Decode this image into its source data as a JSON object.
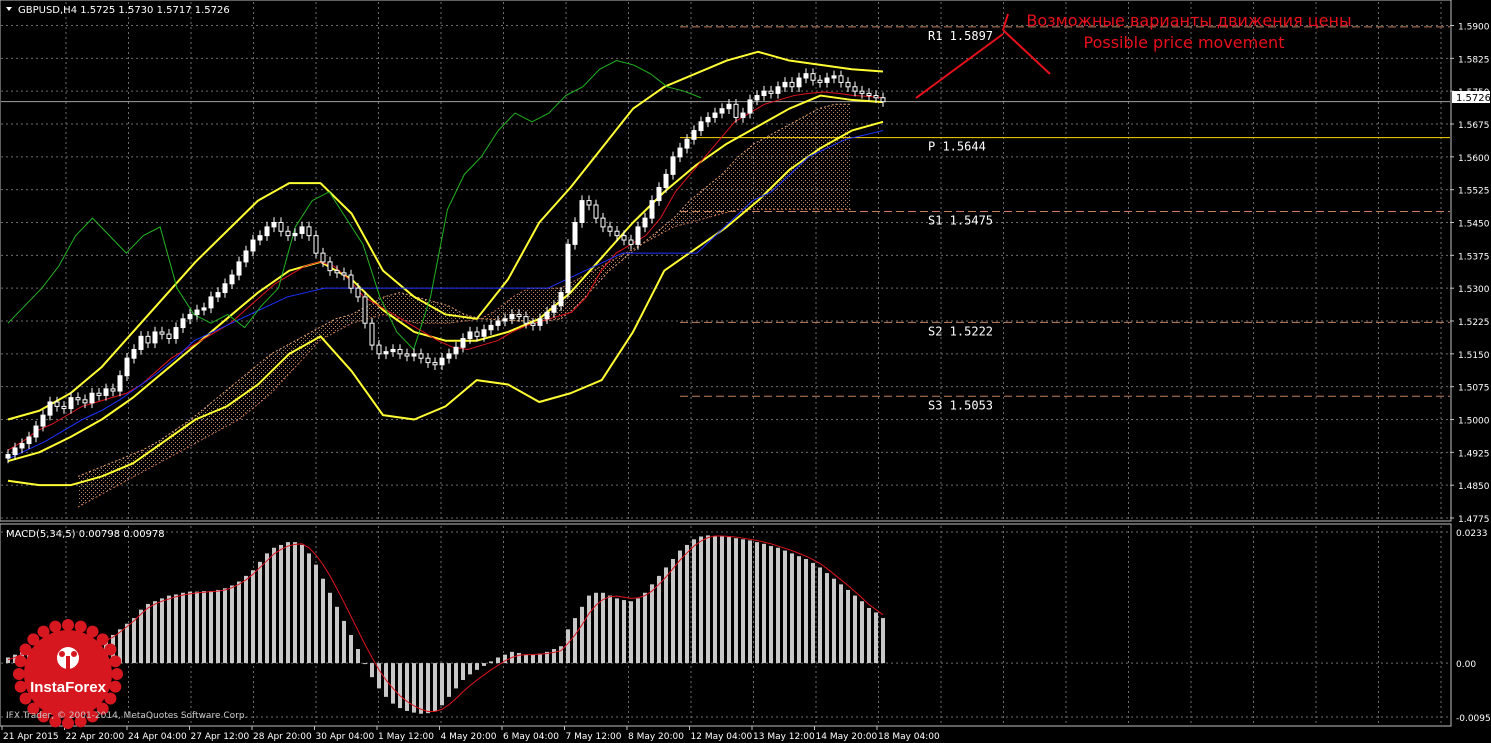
{
  "chart_data": [
    {
      "type": "candlestick",
      "instrument_line": "GBPUSD,H4  1.5725 1.5730 1.5717 1.5726",
      "last_price": "1.5726",
      "y_range": [
        1.4775,
        1.594
      ],
      "y_ticks": [
        "1.5900",
        "1.5825",
        "1.5750",
        "1.5675",
        "1.5600",
        "1.5525",
        "1.5450",
        "1.5375",
        "1.5300",
        "1.5225",
        "1.5150",
        "1.5075",
        "1.5000",
        "1.4925",
        "1.4850",
        "1.4775"
      ],
      "x_labels": [
        "21 Apr 2015",
        "22 Apr 20:00",
        "24 Apr 04:00",
        "27 Apr 12:00",
        "28 Apr 20:00",
        "30 Apr 04:00",
        "1 May 12:00",
        "4 May 20:00",
        "6 May 04:00",
        "7 May 12:00",
        "8 May 20:00",
        "12 May 04:00",
        "13 May 12:00",
        "14 May 20:00",
        "18 May 04:00"
      ],
      "levels": [
        {
          "label": "R1  1.5897",
          "value": 1.5897,
          "color": "#c08060",
          "style": "dashed"
        },
        {
          "label": "P  1.5644",
          "value": 1.5644,
          "color": "#ffd700",
          "style": "solid"
        },
        {
          "label": "S1  1.5475",
          "value": 1.5475,
          "color": "#c08060",
          "style": "dashed"
        },
        {
          "label": "S2  1.5222",
          "value": 1.5222,
          "color": "#c08060",
          "style": "dashed"
        },
        {
          "label": "S3  1.5053",
          "value": 1.5053,
          "color": "#c08060",
          "style": "dashed"
        }
      ],
      "annotation": {
        "line1": "Возможные варианты движения цены",
        "line2": "Possible price movement",
        "color": "#e8101a"
      },
      "closes": [
        1.492,
        1.4935,
        1.4945,
        1.496,
        1.4985,
        1.501,
        1.504,
        1.503,
        1.5025,
        1.505,
        1.5045,
        1.5038,
        1.506,
        1.5055,
        1.507,
        1.5065,
        1.51,
        1.514,
        1.516,
        1.519,
        1.5175,
        1.52,
        1.5195,
        1.5185,
        1.521,
        1.523,
        1.524,
        1.525,
        1.5255,
        1.528,
        1.529,
        1.531,
        1.533,
        1.536,
        1.5385,
        1.541,
        1.542,
        1.544,
        1.545,
        1.543,
        1.542,
        1.5425,
        1.544,
        1.542,
        1.538,
        1.536,
        1.534,
        1.5335,
        1.533,
        1.53,
        1.528,
        1.522,
        1.517,
        1.515,
        1.5155,
        1.516,
        1.515,
        1.5145,
        1.515,
        1.514,
        1.513,
        1.5125,
        1.514,
        1.515,
        1.5165,
        1.5185,
        1.52,
        1.519,
        1.5205,
        1.5215,
        1.5225,
        1.523,
        1.524,
        1.5235,
        1.522,
        1.5215,
        1.523,
        1.5245,
        1.526,
        1.529,
        1.54,
        1.545,
        1.55,
        1.549,
        1.546,
        1.544,
        1.543,
        1.542,
        1.541,
        1.54,
        1.544,
        1.546,
        1.55,
        1.553,
        1.556,
        1.56,
        1.562,
        1.564,
        1.566,
        1.568,
        1.569,
        1.57,
        1.571,
        1.572,
        1.569,
        1.57,
        1.573,
        1.574,
        1.575,
        1.5745,
        1.576,
        1.577,
        1.576,
        1.578,
        1.579,
        1.5775,
        1.577,
        1.578,
        1.5785,
        1.577,
        1.576,
        1.575,
        1.5745,
        1.574,
        1.5735,
        1.5726
      ],
      "ichimoku": {
        "tenkan": [
          1.493,
          1.495,
          1.4975,
          1.499,
          1.501,
          1.503,
          1.504,
          1.505,
          1.506,
          1.508,
          1.511,
          1.514,
          1.516,
          1.518,
          1.52,
          1.522,
          1.525,
          1.528,
          1.531,
          1.533,
          1.535,
          1.536,
          1.535,
          1.532,
          1.528,
          1.526,
          1.524,
          1.522,
          1.52,
          1.518,
          1.5165,
          1.516,
          1.517,
          1.518,
          1.52,
          1.5215,
          1.5225,
          1.5235,
          1.5245,
          1.528,
          1.534,
          1.538,
          1.54,
          1.542,
          1.546,
          1.552,
          1.556,
          1.56,
          1.564,
          1.568,
          1.57,
          1.572,
          1.573,
          1.574,
          1.5745,
          1.5748,
          1.5745,
          1.574,
          1.5738,
          1.5735
        ],
        "kijun": [
          1.491,
          1.493,
          1.495,
          1.4975,
          1.5,
          1.502,
          1.5045,
          1.5075,
          1.5105,
          1.514,
          1.518,
          1.52,
          1.522,
          1.524,
          1.526,
          1.528,
          1.529,
          1.53,
          1.53,
          1.53,
          1.53,
          1.53,
          1.53,
          1.53,
          1.53,
          1.53,
          1.53,
          1.53,
          1.53,
          1.53,
          1.532,
          1.534,
          1.536,
          1.538,
          1.538,
          1.538,
          1.538,
          1.538,
          1.542,
          1.546,
          1.55,
          1.552,
          1.556,
          1.56,
          1.562,
          1.564,
          1.565,
          1.566
        ],
        "chikou": [
          1.522,
          1.526,
          1.53,
          1.535,
          1.542,
          1.546,
          1.542,
          1.538,
          1.542,
          1.544,
          1.53,
          1.524,
          1.522,
          1.524,
          1.521,
          1.526,
          1.53,
          1.544,
          1.55,
          1.552,
          1.546,
          1.54,
          1.528,
          1.52,
          1.516,
          1.528,
          1.548,
          1.556,
          1.56,
          1.566,
          1.57,
          1.568,
          1.57,
          1.574,
          1.576,
          1.58,
          1.582,
          1.581,
          1.579,
          1.576,
          1.575,
          1.5735
        ],
        "span_a": [
          1.487,
          1.4885,
          1.49,
          1.4915,
          1.493,
          1.495,
          1.4975,
          1.5,
          1.503,
          1.506,
          1.509,
          1.512,
          1.515,
          1.517,
          1.519,
          1.521,
          1.523,
          1.524,
          1.526,
          1.528,
          1.529,
          1.528,
          1.527,
          1.526,
          1.524,
          1.523,
          1.5228,
          1.5226,
          1.5225,
          1.5225,
          1.523,
          1.526,
          1.53,
          1.534,
          1.537,
          1.54,
          1.543,
          1.546,
          1.55,
          1.553,
          1.556,
          1.56,
          1.563,
          1.565,
          1.567,
          1.569,
          1.571,
          1.572,
          1.572
        ],
        "span_b": [
          1.48,
          1.482,
          1.484,
          1.486,
          1.488,
          1.49,
          1.492,
          1.494,
          1.496,
          1.498,
          1.5,
          1.503,
          1.506,
          1.51,
          1.514,
          1.518,
          1.52,
          1.522,
          1.523,
          1.524,
          1.523,
          1.522,
          1.522,
          1.522,
          1.5225,
          1.523,
          1.525,
          1.528,
          1.53,
          1.53,
          1.53,
          1.532,
          1.534,
          1.536,
          1.538,
          1.54,
          1.542,
          1.544,
          1.545,
          1.546,
          1.547,
          1.548,
          1.548,
          1.548,
          1.548,
          1.548,
          1.548,
          1.548,
          1.548
        ]
      },
      "bollinger": {
        "middle": [
          1.4905,
          1.4925,
          1.496,
          1.5,
          1.505,
          1.511,
          1.517,
          1.523,
          1.529,
          1.534,
          1.536,
          1.532,
          1.525,
          1.52,
          1.518,
          1.518,
          1.52,
          1.523,
          1.529,
          1.537,
          1.545,
          1.552,
          1.558,
          1.563,
          1.567,
          1.571,
          1.574,
          1.573,
          1.5725
        ],
        "upper": [
          1.5,
          1.502,
          1.506,
          1.512,
          1.52,
          1.528,
          1.536,
          1.543,
          1.55,
          1.554,
          1.554,
          1.547,
          1.534,
          1.528,
          1.524,
          1.523,
          1.532,
          1.545,
          1.553,
          1.562,
          1.571,
          1.576,
          1.579,
          1.582,
          1.584,
          1.582,
          1.581,
          1.58,
          1.5795
        ],
        "lower": [
          1.486,
          1.485,
          1.485,
          1.487,
          1.49,
          1.495,
          1.5,
          1.503,
          1.508,
          1.515,
          1.519,
          1.511,
          1.501,
          1.5,
          1.503,
          1.509,
          1.508,
          1.504,
          1.506,
          1.509,
          1.52,
          1.534,
          1.539,
          1.544,
          1.55,
          1.557,
          1.562,
          1.566,
          1.568
        ]
      }
    },
    {
      "type": "bar",
      "title": "MACD(5,34,5) 0.00798 0.00978",
      "y_range": [
        -0.00958,
        0.0233
      ],
      "y_ticks": [
        "0.0233",
        "0.00",
        "-0.00958"
      ],
      "histogram": [
        0.001,
        0.0015,
        0.002,
        0.0025,
        0.003,
        0.0035,
        0.0038,
        0.004,
        0.0042,
        0.004,
        0.0038,
        0.0035,
        0.0035,
        0.004,
        0.0045,
        0.005,
        0.006,
        0.007,
        0.008,
        0.0095,
        0.0105,
        0.011,
        0.0115,
        0.012,
        0.0122,
        0.0125,
        0.0127,
        0.0127,
        0.0128,
        0.0128,
        0.013,
        0.0133,
        0.0138,
        0.0145,
        0.0155,
        0.0165,
        0.018,
        0.0195,
        0.0205,
        0.021,
        0.0215,
        0.0215,
        0.021,
        0.0195,
        0.0175,
        0.015,
        0.0125,
        0.01,
        0.0075,
        0.005,
        0.0025,
        0.0,
        -0.0025,
        -0.0045,
        -0.006,
        -0.0072,
        -0.008,
        -0.0085,
        -0.0088,
        -0.009,
        -0.0089,
        -0.0085,
        -0.0075,
        -0.006,
        -0.0045,
        -0.003,
        -0.002,
        -0.0012,
        -0.0005,
        0.0003,
        0.001,
        0.0015,
        0.002,
        0.0018,
        0.0015,
        0.0015,
        0.0017,
        0.002,
        0.0025,
        0.003,
        0.006,
        0.008,
        0.01,
        0.012,
        0.0125,
        0.0125,
        0.012,
        0.0115,
        0.0112,
        0.011,
        0.0115,
        0.0125,
        0.014,
        0.0155,
        0.017,
        0.0185,
        0.02,
        0.021,
        0.022,
        0.0225,
        0.0227,
        0.0226,
        0.0225,
        0.0224,
        0.0222,
        0.022,
        0.0218,
        0.0215,
        0.0212,
        0.0208,
        0.0205,
        0.02,
        0.0195,
        0.019,
        0.0185,
        0.0178,
        0.017,
        0.016,
        0.015,
        0.014,
        0.013,
        0.012,
        0.011,
        0.0098,
        0.009,
        0.008
      ],
      "signal": [
        0.0006,
        0.001,
        0.0016,
        0.0022,
        0.0028,
        0.0033,
        0.0036,
        0.0038,
        0.0039,
        0.0039,
        0.0037,
        0.0036,
        0.0035,
        0.0036,
        0.004,
        0.0046,
        0.0055,
        0.0065,
        0.0075,
        0.0087,
        0.0098,
        0.0105,
        0.011,
        0.0114,
        0.0118,
        0.0121,
        0.0123,
        0.0125,
        0.0126,
        0.0127,
        0.0128,
        0.013,
        0.0134,
        0.014,
        0.0148,
        0.0158,
        0.017,
        0.0182,
        0.0194,
        0.0202,
        0.0208,
        0.0211,
        0.0212,
        0.0205,
        0.0192,
        0.0175,
        0.0155,
        0.0132,
        0.0108,
        0.0083,
        0.0058,
        0.0033,
        0.001,
        -0.0012,
        -0.003,
        -0.0045,
        -0.0058,
        -0.0068,
        -0.0076,
        -0.0082,
        -0.0086,
        -0.0086,
        -0.0082,
        -0.0074,
        -0.0063,
        -0.0051,
        -0.004,
        -0.003,
        -0.0021,
        -0.0012,
        -0.0004,
        0.0004,
        0.001,
        0.0014,
        0.0015,
        0.0015,
        0.0016,
        0.0017,
        0.0019,
        0.0022,
        0.0035,
        0.005,
        0.0068,
        0.0088,
        0.0103,
        0.0113,
        0.0118,
        0.0119,
        0.0117,
        0.0115,
        0.0116,
        0.012,
        0.0128,
        0.014,
        0.0153,
        0.0168,
        0.0183,
        0.0196,
        0.0208,
        0.0217,
        0.0223,
        0.0226,
        0.0226,
        0.0225,
        0.0224,
        0.0222,
        0.022,
        0.0218,
        0.0215,
        0.0212,
        0.0208,
        0.0204,
        0.02,
        0.0195,
        0.019,
        0.0184,
        0.0177,
        0.0168,
        0.0158,
        0.0148,
        0.0138,
        0.0127,
        0.0116,
        0.0104,
        0.0095,
        0.0086
      ]
    }
  ],
  "ui": {
    "logo_text": "InstaForex",
    "copyright": "IFX Trader, © 2001-2014, MetaQuotes Software Corp."
  }
}
